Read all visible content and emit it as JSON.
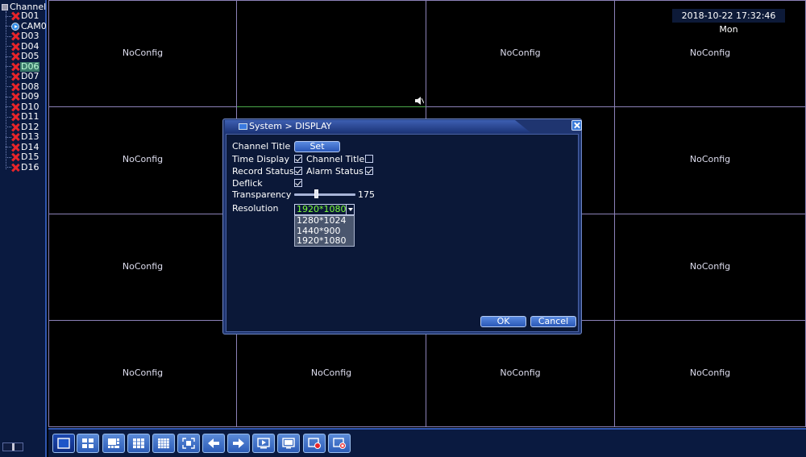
{
  "sidebar": {
    "root_label": "Channel",
    "channels": [
      {
        "label": "D01",
        "status": "error"
      },
      {
        "label": "CAM0",
        "status": "camera"
      },
      {
        "label": "D03",
        "status": "error"
      },
      {
        "label": "D04",
        "status": "error"
      },
      {
        "label": "D05",
        "status": "error"
      },
      {
        "label": "D06",
        "status": "error",
        "selected": true
      },
      {
        "label": "D07",
        "status": "error"
      },
      {
        "label": "D08",
        "status": "error"
      },
      {
        "label": "D09",
        "status": "error"
      },
      {
        "label": "D10",
        "status": "error"
      },
      {
        "label": "D11",
        "status": "error"
      },
      {
        "label": "D12",
        "status": "error"
      },
      {
        "label": "D13",
        "status": "error"
      },
      {
        "label": "D14",
        "status": "error"
      },
      {
        "label": "D15",
        "status": "error"
      },
      {
        "label": "D16",
        "status": "error"
      }
    ]
  },
  "grid": {
    "cells": [
      "NoConfig",
      "",
      "NoConfig",
      "NoConfig",
      "NoConfig",
      "",
      "",
      "NoConfig",
      "NoConfig",
      "",
      "",
      "NoConfig",
      "NoConfig",
      "NoConfig",
      "NoConfig",
      "NoConfig"
    ]
  },
  "datetime": "2018-10-22 17:32:46 Mon",
  "dialog": {
    "title": "System > DISPLAY",
    "channel_title_label": "Channel Title",
    "set_button": "Set",
    "time_display_label": "Time Display",
    "time_display_checked": true,
    "channel_title_check_label": "Channel Title",
    "channel_title_checked": false,
    "record_status_label": "Record Status",
    "record_status_checked": true,
    "alarm_status_label": "Alarm Status",
    "alarm_status_checked": true,
    "deflick_label": "Deflick",
    "deflick_checked": true,
    "transparency_label": "Transparency",
    "transparency_value": "175",
    "resolution_label": "Resolution",
    "resolution_value": "1920*1080",
    "resolution_options": [
      "1280*1024",
      "1440*900",
      "1920*1080"
    ],
    "ok_button": "OK",
    "cancel_button": "Cancel"
  },
  "toolbar": {
    "buttons": [
      "single-view-icon",
      "quad-view-icon",
      "eight-view-icon",
      "nine-view-icon",
      "sixteen-view-icon",
      "fullscreen-icon",
      "previous-icon",
      "next-icon",
      "playback-icon",
      "display-icon",
      "record-icon",
      "stop-record-icon"
    ]
  },
  "colors": {
    "error_red": "#e8242a",
    "selection_green": "#7dff3a",
    "grid_line": "#8c82b8",
    "panel_blue": "#1f3570"
  }
}
